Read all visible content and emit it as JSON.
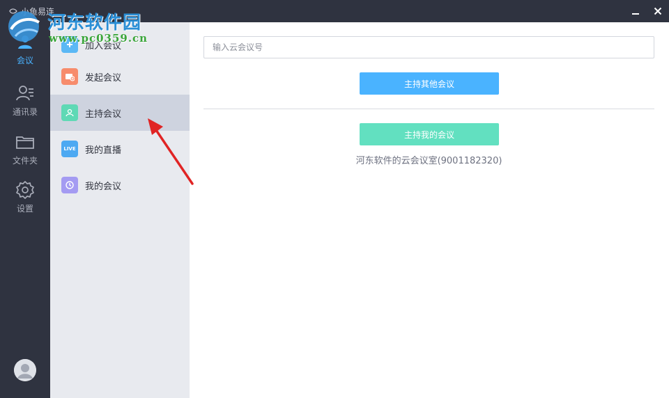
{
  "titlebar": {
    "app_name": "小鱼易连"
  },
  "watermark": {
    "line1": "河东软件园",
    "line2": "www.pc0359.cn"
  },
  "rail": {
    "items": [
      {
        "label": "会议",
        "icon": "meeting-icon",
        "active": true
      },
      {
        "label": "通讯录",
        "icon": "contacts-icon",
        "active": false
      },
      {
        "label": "文件夹",
        "icon": "folder-icon",
        "active": false
      },
      {
        "label": "设置",
        "icon": "settings-icon",
        "active": false
      }
    ]
  },
  "subnav": {
    "items": [
      {
        "label": "加入会议",
        "icon": "join-meeting-icon",
        "color": "#5bb8f5"
      },
      {
        "label": "发起会议",
        "icon": "start-meeting-icon",
        "color": "#f78c6c"
      },
      {
        "label": "主持会议",
        "icon": "host-meeting-icon",
        "color": "#5fd9b5",
        "selected": true
      },
      {
        "label": "我的直播",
        "icon": "live-icon",
        "color": "#4da9f2",
        "badge": "LIVE"
      },
      {
        "label": "我的会议",
        "icon": "my-meetings-clock-icon",
        "color": "#a49bf2"
      }
    ]
  },
  "main": {
    "input_placeholder": "输入云会议号",
    "input_value": "",
    "host_other_label": "主持其他会议",
    "host_mine_label": "主持我的会议",
    "room_caption": "河东软件的云会议室(9001182320)"
  },
  "colors": {
    "rail_bg": "#2f3340",
    "accent_blue": "#4ab3ff",
    "accent_green": "#62e0c0",
    "subnav_bg": "#e8eaef",
    "subnav_selected": "#ced3df",
    "annotation_red": "#e02424"
  }
}
